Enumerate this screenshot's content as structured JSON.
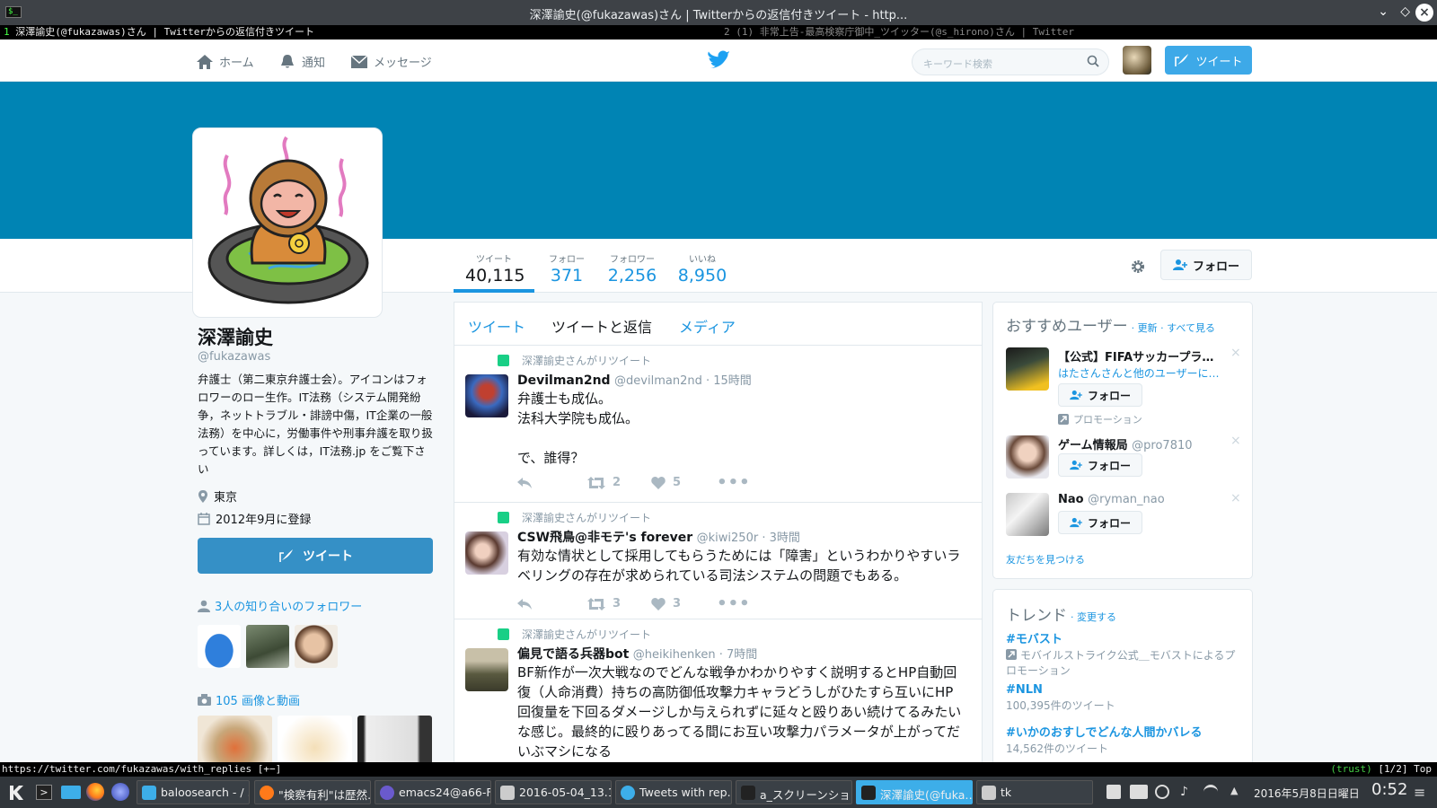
{
  "window": {
    "title": "深澤諭史(@fukazawas)さん | Twitterからの返信付きツイート - http..."
  },
  "screen_tabs": {
    "tab1_num": "1",
    "tab1": "深澤諭史(@fukazawas)さん | Twitterからの返信付きツイート",
    "tab2": "2 (1) 非常上告-最高検察庁御中_ツイッター(@s_hirono)さん | Twitter"
  },
  "nav": {
    "home": "ホーム",
    "notifications": "通知",
    "messages": "メッセージ",
    "search_placeholder": "キーワード検索",
    "tweet": "ツイート"
  },
  "profile": {
    "stats": [
      {
        "label": "ツイート",
        "value": "40,115"
      },
      {
        "label": "フォロー",
        "value": "371"
      },
      {
        "label": "フォロワー",
        "value": "2,256"
      },
      {
        "label": "いいね",
        "value": "8,950"
      }
    ],
    "follow": "フォロー",
    "name": "深澤諭史",
    "handle": "@fukazawas",
    "bio": "弁護士（第二東京弁護士会）。アイコンはフォロワーのロー生作。IT法務（システム開発紛争，ネットトラブル・誹謗中傷，IT企業の一般法務）を中心に，労働事件や刑事弁護を取り扱っています。詳しくは，IT法務.jp をご覧下さい",
    "location": "東京",
    "joined": "2012年9月に登録",
    "tweet_button": "ツイート",
    "known_followers": "3人の知り合いのフォロワー",
    "media": "105 画像と動画"
  },
  "timeline": {
    "tabs": [
      "ツイート",
      "ツイートと返信",
      "メディア"
    ],
    "tweets": [
      {
        "rt": "深澤諭史さんがリツイート",
        "name": "Devilman2nd",
        "handle": "@devilman2nd · 15時間",
        "text": [
          "弁護士も成仏。",
          "法科大学院も成仏。",
          "",
          "で、誰得？"
        ],
        "retweets": "2",
        "likes": "5"
      },
      {
        "rt": "深澤諭史さんがリツイート",
        "name": "CSW飛鳥@非モテ's forever",
        "handle": "@kiwi250r · 3時間",
        "text": [
          "有効な情状として採用してもらうためには「障害」というわかりやすいラベリングの存在が求められている司法システムの問題でもある。"
        ],
        "retweets": "3",
        "likes": "3"
      },
      {
        "rt": "深澤諭史さんがリツイート",
        "name": "偏見で語る兵器bot",
        "handle": "@heikihenken · 7時間",
        "text": [
          "BF新作が一次大戦なのでどんな戦争かわかりやすく説明するとHP自動回復（人命消費）持ちの高防御低攻撃力キャラどうしがひたすら互いにHP回復量を下回るダメージしか与えられずに延々と殴りあい続けてるみたいな感じ。最終的に殴りあってる間にお互い攻撃力パラメータが上がってだいぶマシになる"
        ]
      }
    ]
  },
  "who_to_follow": {
    "title": "おすすめユーザー",
    "refresh": "· 更新 · すべて見る",
    "users": [
      {
        "name": "【公式】FIFAサッカープライム…",
        "handle": "",
        "sub": "はたさんさんと他のユーザーに…",
        "follow": "フォロー",
        "promo": "プロモーション"
      },
      {
        "name": "ゲーム情報局",
        "handle": "@pro7810",
        "follow": "フォロー"
      },
      {
        "name": "Nao",
        "handle": "@ryman_nao",
        "follow": "フォロー"
      }
    ],
    "find_friends": "友だちを見つける"
  },
  "trends": {
    "title": "トレンド",
    "change": "· 変更する",
    "items": [
      {
        "tag": "#モバスト",
        "desc": "モバイルストライク公式＿モバストによるプロモーション"
      },
      {
        "tag": "#NLN",
        "desc": "100,395件のツイート"
      },
      {
        "tag": "#いかのおすしでどんな人間かバレる",
        "desc": "14,562件のツイート"
      }
    ]
  },
  "statusline": {
    "url": "https://twitter.com/fukazawas/with_replies [+−]",
    "trust": "(trust)",
    "pos": "[1/2] Top"
  },
  "taskbar": {
    "tasks": [
      "baloosearch - / …",
      "\"検察有利\"は歴然…",
      "emacs24@a66-F…",
      "2016-05-04_13.1…",
      "Tweets with rep…",
      "a_スクリーンショ…",
      "深澤諭史(@fuka…",
      "tk"
    ],
    "date": "2016年5月8日日曜日",
    "time": "0:52"
  },
  "colors": {
    "banner": "#0084b4",
    "link": "#1b95e0",
    "tweet_button": "#3590c6"
  }
}
